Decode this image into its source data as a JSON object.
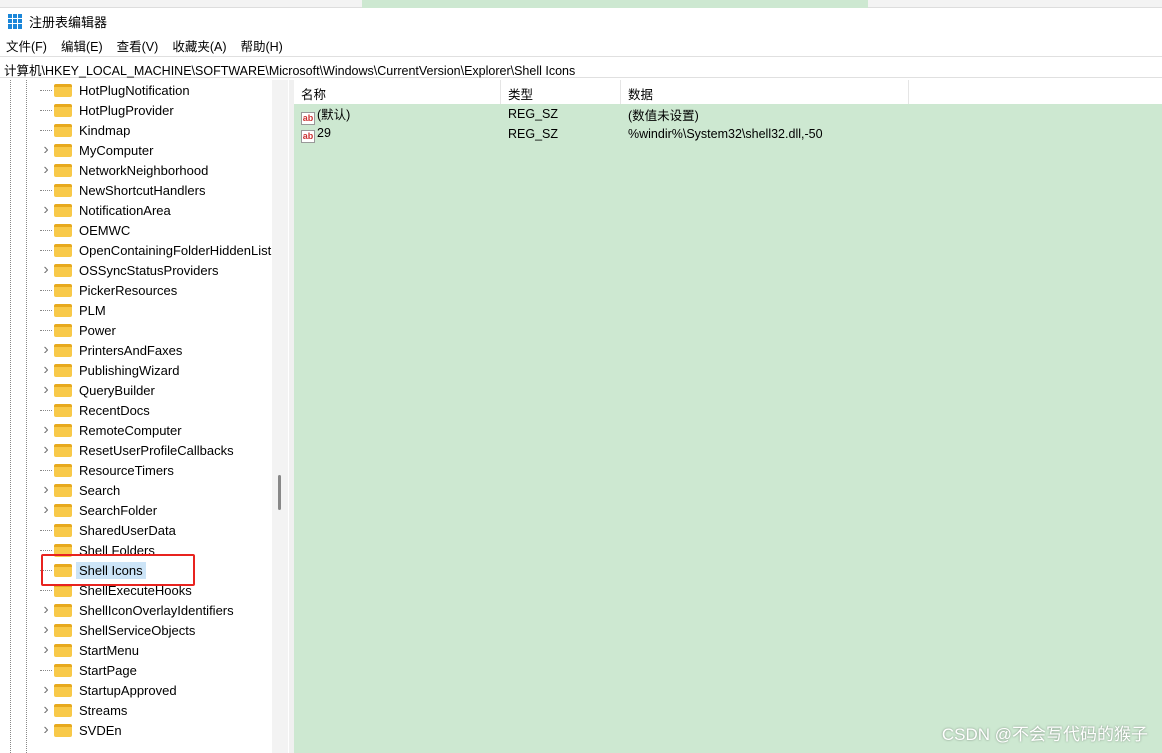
{
  "window": {
    "title": "注册表编辑器"
  },
  "menu": [
    "文件(F)",
    "编辑(E)",
    "查看(V)",
    "收藏夹(A)",
    "帮助(H)"
  ],
  "address": "计算机\\HKEY_LOCAL_MACHINE\\SOFTWARE\\Microsoft\\Windows\\CurrentVersion\\Explorer\\Shell Icons",
  "tree": [
    {
      "label": "HotPlugNotification",
      "expandable": false
    },
    {
      "label": "HotPlugProvider",
      "expandable": false
    },
    {
      "label": "Kindmap",
      "expandable": false
    },
    {
      "label": "MyComputer",
      "expandable": true
    },
    {
      "label": "NetworkNeighborhood",
      "expandable": true
    },
    {
      "label": "NewShortcutHandlers",
      "expandable": false
    },
    {
      "label": "NotificationArea",
      "expandable": true
    },
    {
      "label": "OEMWC",
      "expandable": false
    },
    {
      "label": "OpenContainingFolderHiddenList",
      "expandable": false
    },
    {
      "label": "OSSyncStatusProviders",
      "expandable": true
    },
    {
      "label": "PickerResources",
      "expandable": false
    },
    {
      "label": "PLM",
      "expandable": false
    },
    {
      "label": "Power",
      "expandable": false
    },
    {
      "label": "PrintersAndFaxes",
      "expandable": true
    },
    {
      "label": "PublishingWizard",
      "expandable": true
    },
    {
      "label": "QueryBuilder",
      "expandable": true
    },
    {
      "label": "RecentDocs",
      "expandable": false
    },
    {
      "label": "RemoteComputer",
      "expandable": true
    },
    {
      "label": "ResetUserProfileCallbacks",
      "expandable": true
    },
    {
      "label": "ResourceTimers",
      "expandable": false
    },
    {
      "label": "Search",
      "expandable": true
    },
    {
      "label": "SearchFolder",
      "expandable": true
    },
    {
      "label": "SharedUserData",
      "expandable": false
    },
    {
      "label": "Shell Folders",
      "expandable": false
    },
    {
      "label": "Shell Icons",
      "expandable": false,
      "selected": true
    },
    {
      "label": "ShellExecuteHooks",
      "expandable": false
    },
    {
      "label": "ShellIconOverlayIdentifiers",
      "expandable": true
    },
    {
      "label": "ShellServiceObjects",
      "expandable": true
    },
    {
      "label": "StartMenu",
      "expandable": true
    },
    {
      "label": "StartPage",
      "expandable": false
    },
    {
      "label": "StartupApproved",
      "expandable": true
    },
    {
      "label": "Streams",
      "expandable": true
    },
    {
      "label": "SVDEn",
      "expandable": true
    }
  ],
  "columns": {
    "name": "名称",
    "type": "类型",
    "data": "数据"
  },
  "values": [
    {
      "name": "(默认)",
      "type": "REG_SZ",
      "data": "(数值未设置)"
    },
    {
      "name": "29",
      "type": "REG_SZ",
      "data": "%windir%\\System32\\shell32.dll,-50"
    }
  ],
  "watermark": "CSDN @不会写代码的猴子",
  "icon_ab": "ab"
}
